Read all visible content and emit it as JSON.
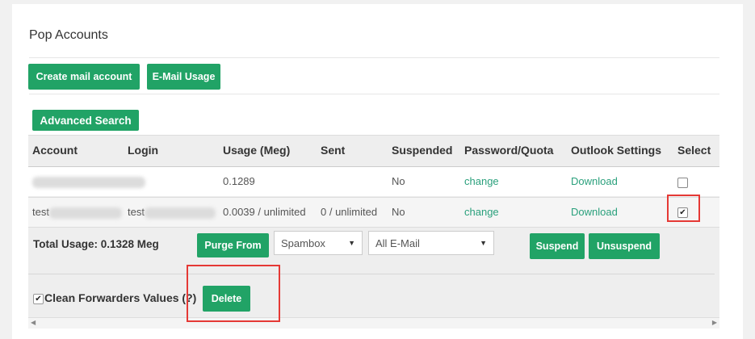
{
  "page": {
    "title": "Pop Accounts"
  },
  "toolbar": {
    "create_label": "Create mail account",
    "usage_label": "E-Mail Usage",
    "advanced_search_label": "Advanced Search"
  },
  "table": {
    "headers": [
      "Account",
      "Login",
      "Usage (Meg)",
      "Sent",
      "Suspended",
      "Password/Quota",
      "Outlook Settings",
      "Select"
    ],
    "rows": [
      {
        "account": "",
        "login": "",
        "usage": "0.1289",
        "sent": "",
        "suspended": "No",
        "password": "change",
        "outlook": "Download",
        "selected": false
      },
      {
        "account": "test",
        "login": "test",
        "usage": "0.0039 / unlimited",
        "sent": "0 / unlimited",
        "suspended": "No",
        "password": "change",
        "outlook": "Download",
        "selected": true
      }
    ]
  },
  "footer": {
    "total_usage": "Total Usage: 0.1328 Meg",
    "purge_label": "Purge From",
    "folder_select": "Spambox",
    "type_select": "All E-Mail",
    "suspend_label": "Suspend",
    "unsuspend_label": "Unsuspend",
    "clean_forwarders_label": "Clean Forwarders Values",
    "help_label": "(?)",
    "clean_forwarders_checked": true,
    "delete_label": "Delete"
  },
  "colors": {
    "button_green": "#21a366",
    "link_green": "#2aa07c",
    "highlight_red": "#e53935"
  },
  "icons": [
    "checkbox-checked-icon",
    "dropdown-caret-icon",
    "scroll-left-icon",
    "scroll-right-icon"
  ]
}
